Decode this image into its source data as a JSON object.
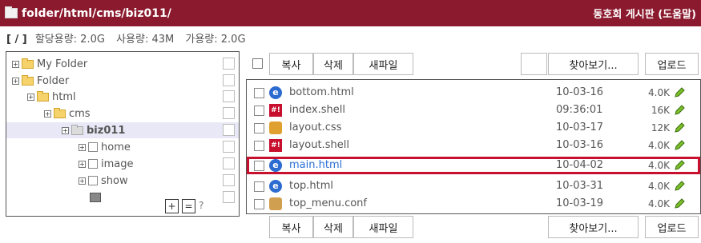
{
  "header": {
    "path": "folder/html/cms/biz011/",
    "brand": "동호회 게시판 (도움말)"
  },
  "quota": {
    "root": "[ / ]",
    "allocated": "할당용량: 2.0G",
    "used": "사용량: 43M",
    "available": "가용량: 2.0G"
  },
  "tree": {
    "items": [
      {
        "label": "My Folder"
      },
      {
        "label": "Folder"
      },
      {
        "label": "html"
      },
      {
        "label": "cms"
      },
      {
        "label": "biz011"
      },
      {
        "label": "home"
      },
      {
        "label": "image"
      },
      {
        "label": "show"
      }
    ],
    "plus_label": "+",
    "equal_label": "=",
    "help_label": "?"
  },
  "toolbar": {
    "copy": "복사",
    "delete": "삭제",
    "new_file": "새파일",
    "browse": "찾아보기...",
    "upload": "업로드"
  },
  "files": [
    {
      "name": "bottom.html",
      "date": "10-03-16",
      "size": "4.0K",
      "icon": "html-file-icon"
    },
    {
      "name": "index.shell",
      "date": "09:36:01",
      "size": "16K",
      "icon": "shell-file-icon"
    },
    {
      "name": "layout.css",
      "date": "10-03-17",
      "size": "12K",
      "icon": "css-file-icon"
    },
    {
      "name": "layout.shell",
      "date": "10-03-16",
      "size": "4.0K",
      "icon": "shell-file-icon"
    },
    {
      "name": "main.html",
      "date": "10-04-02",
      "size": "4.0K",
      "icon": "html-file-icon"
    },
    {
      "name": "top.html",
      "date": "10-03-31",
      "size": "4.0K",
      "icon": "html-file-icon"
    },
    {
      "name": "top_menu.conf",
      "date": "10-03-19",
      "size": "4.0K",
      "icon": "conf-file-icon"
    }
  ],
  "colors": {
    "titlebar": "#8b1a2e",
    "highlight": "#c8102e",
    "selected_link": "#2a6fd4"
  }
}
